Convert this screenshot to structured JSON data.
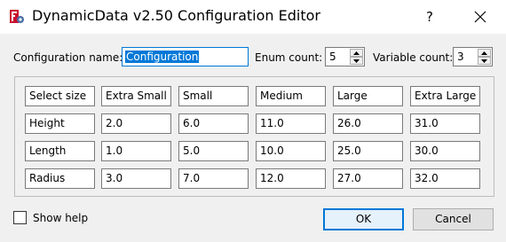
{
  "window": {
    "title": "DynamicData v2.50 Configuration Editor",
    "help_label": "?",
    "app_icon": "dynamicdata-app-icon",
    "accent_color": "#0078d7"
  },
  "top": {
    "config_name_label": "Configuration name:",
    "config_name_value": "Configuration",
    "enum_count_label": "Enum count:",
    "enum_count_value": "5",
    "variable_count_label": "Variable count:",
    "variable_count_value": "3"
  },
  "grid": {
    "rows": [
      [
        "Select size",
        "Extra Small",
        "Small",
        "Medium",
        "Large",
        "Extra Large"
      ],
      [
        "Height",
        "2.0",
        "6.0",
        "11.0",
        "26.0",
        "31.0"
      ],
      [
        "Length",
        "1.0",
        "5.0",
        "10.0",
        "25.0",
        "30.0"
      ],
      [
        "Radius",
        "3.0",
        "7.0",
        "12.0",
        "27.0",
        "32.0"
      ]
    ]
  },
  "footer": {
    "show_help_label": "Show help",
    "show_help_checked": false,
    "ok_label": "OK",
    "cancel_label": "Cancel"
  }
}
